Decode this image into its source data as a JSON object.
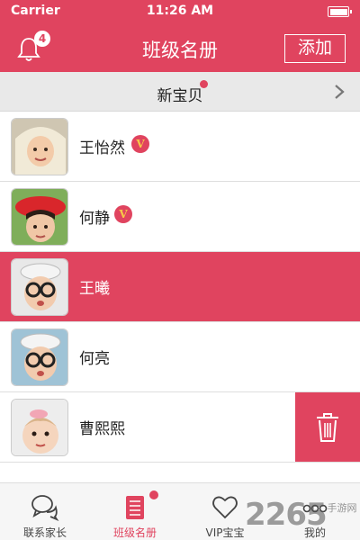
{
  "status_bar": {
    "carrier": "Carrier",
    "time": "11:26 AM"
  },
  "nav": {
    "notification_count": "4",
    "title": "班级名册",
    "add_label": "添加"
  },
  "new_baby": {
    "label": "新宝贝"
  },
  "students": [
    {
      "name": "王怡然",
      "vip": true,
      "vip_label": "V",
      "selected": false
    },
    {
      "name": "何静",
      "vip": true,
      "vip_label": "V",
      "selected": false
    },
    {
      "name": "王曦",
      "vip": false,
      "selected": true
    },
    {
      "name": "何亮",
      "vip": false,
      "selected": false
    },
    {
      "name": "曹熙熙",
      "vip": false,
      "selected": false,
      "swiped": true
    }
  ],
  "tabs": [
    {
      "label": "联系家长",
      "icon": "chat-bubbles-icon",
      "active": false
    },
    {
      "label": "班级名册",
      "icon": "notebook-icon",
      "active": true,
      "dot": true
    },
    {
      "label": "VIP宝宝",
      "icon": "heart-icon",
      "active": false
    },
    {
      "label": "我的",
      "icon": "more-dots-icon",
      "active": false
    }
  ],
  "watermark": {
    "number": "2265",
    "text": ".手游网"
  },
  "colors": {
    "accent": "#e0445f",
    "vip_letter": "#f7c948"
  }
}
